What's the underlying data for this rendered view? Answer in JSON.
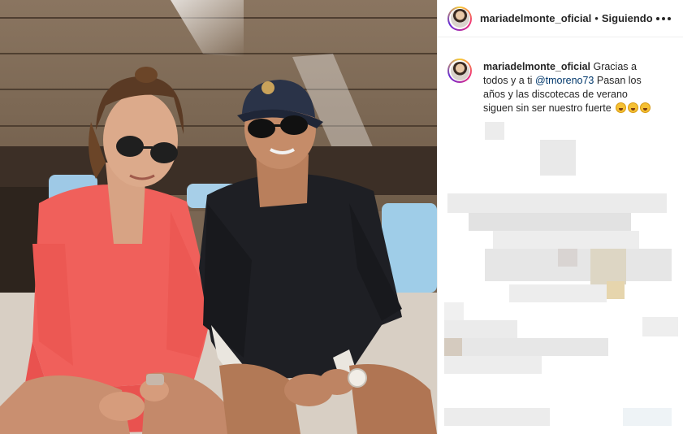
{
  "post": {
    "username": "mariadelmonte_oficial",
    "follow_status": "Siguiendo",
    "separator": "•"
  },
  "caption": {
    "username": "mariadelmonte_oficial",
    "text_before": " Gracias a todos y a ti ",
    "mention": "@tmoreno73",
    "text_after": " Pasan los años y las discotecas de verano siguen sin ser nuestro fuerte ",
    "emojis": [
      "grinning-sweat-emoji",
      "grinning-sweat-emoji",
      "grinning-sweat-emoji"
    ]
  },
  "icons": {
    "more": "more-horizontal-icon"
  },
  "colors": {
    "text": "#262626",
    "mention": "#00376b",
    "border": "#efefef"
  }
}
